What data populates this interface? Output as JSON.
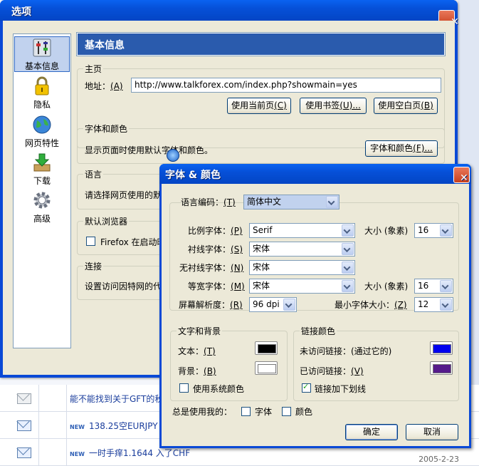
{
  "options_window": {
    "title": "选项",
    "sidebar": [
      {
        "icon": "general-icon",
        "label": "基本信息",
        "selected": true
      },
      {
        "icon": "lock-icon",
        "label": "隐私"
      },
      {
        "icon": "globe-icon",
        "label": "网页特性"
      },
      {
        "icon": "download-icon",
        "label": "下载"
      },
      {
        "icon": "gear-icon",
        "label": "高级"
      }
    ],
    "header": "基本信息",
    "homepage": {
      "group_title": "主页",
      "address_label": "地址：",
      "address_key": "(A)",
      "url": "http://www.talkforex.com/index.php?showmain=yes",
      "btn_current": "使用当前页",
      "btn_current_key": "(C)",
      "btn_bookmark": "使用书签",
      "btn_bookmark_key": "(U)...",
      "btn_blank": "使用空白页",
      "btn_blank_key": "(B)"
    },
    "fonts_colors": {
      "group_title": "字体和颜色",
      "text": "显示页面时使用默认字体和颜色。",
      "btn": "字体和颜色",
      "btn_key": "(F)..."
    },
    "language": {
      "group_title": "语言",
      "text": "请选择网页使用的默认"
    },
    "default_browser": {
      "group_title": "默认浏览器",
      "text": "Firefox 在启动时"
    },
    "connection": {
      "group_title": "连接",
      "text": "设置访问因特网的代"
    }
  },
  "fonts_dialog": {
    "title": "字体 & 颜色",
    "encoding_label": "语言编码：",
    "encoding_key": "(T)",
    "encoding_value": "简体中文",
    "proportional_label": "比例字体：",
    "proportional_key": "(P)",
    "proportional_value": "Serif",
    "size_label": "大小 (象素)",
    "proportional_size": "16",
    "serif_label": "衬线字体：",
    "serif_key": "(S)",
    "serif_value": "宋体",
    "sans_label": "无衬线字体：",
    "sans_key": "(N)",
    "sans_value": "宋体",
    "mono_label": "等宽字体：",
    "mono_key": "(M)",
    "mono_value": "宋体",
    "mono_size": "16",
    "resolution_label": "屏幕解析度：",
    "resolution_key": "(R)",
    "resolution_value": "96 dpi",
    "min_size_label": "最小字体大小：",
    "min_size_key": "(Z)",
    "min_size_value": "12",
    "text_bg_group": "文字和背景",
    "text_label": "文本：",
    "text_key": "(T)",
    "text_color": "#000000",
    "bg_label": "背景：",
    "bg_key": "(B)",
    "bg_color": "#ffffff",
    "use_system_colors": "使用系统颜色",
    "link_group": "链接颜色",
    "unvisited_label": "未访问链接：(通过它的)",
    "unvisited_color": "#0000ee",
    "visited_label": "已访问链接：",
    "visited_key": "(V)",
    "visited_color": "#551a8b",
    "underline_links": "链接加下划线",
    "always_use": "总是使用我的：",
    "always_fonts": "字体",
    "always_colors": "颜色",
    "ok": "确定",
    "cancel": "取消"
  },
  "background_page": {
    "rows": [
      {
        "link": "能不能找到关于GFT的秋",
        "new": ""
      },
      {
        "link": "138.25空EURJPY",
        "new": "NEW"
      },
      {
        "link": "一时手痒1.1644 入了CHF",
        "new": "NEW"
      }
    ],
    "date": "2005-2-23"
  }
}
